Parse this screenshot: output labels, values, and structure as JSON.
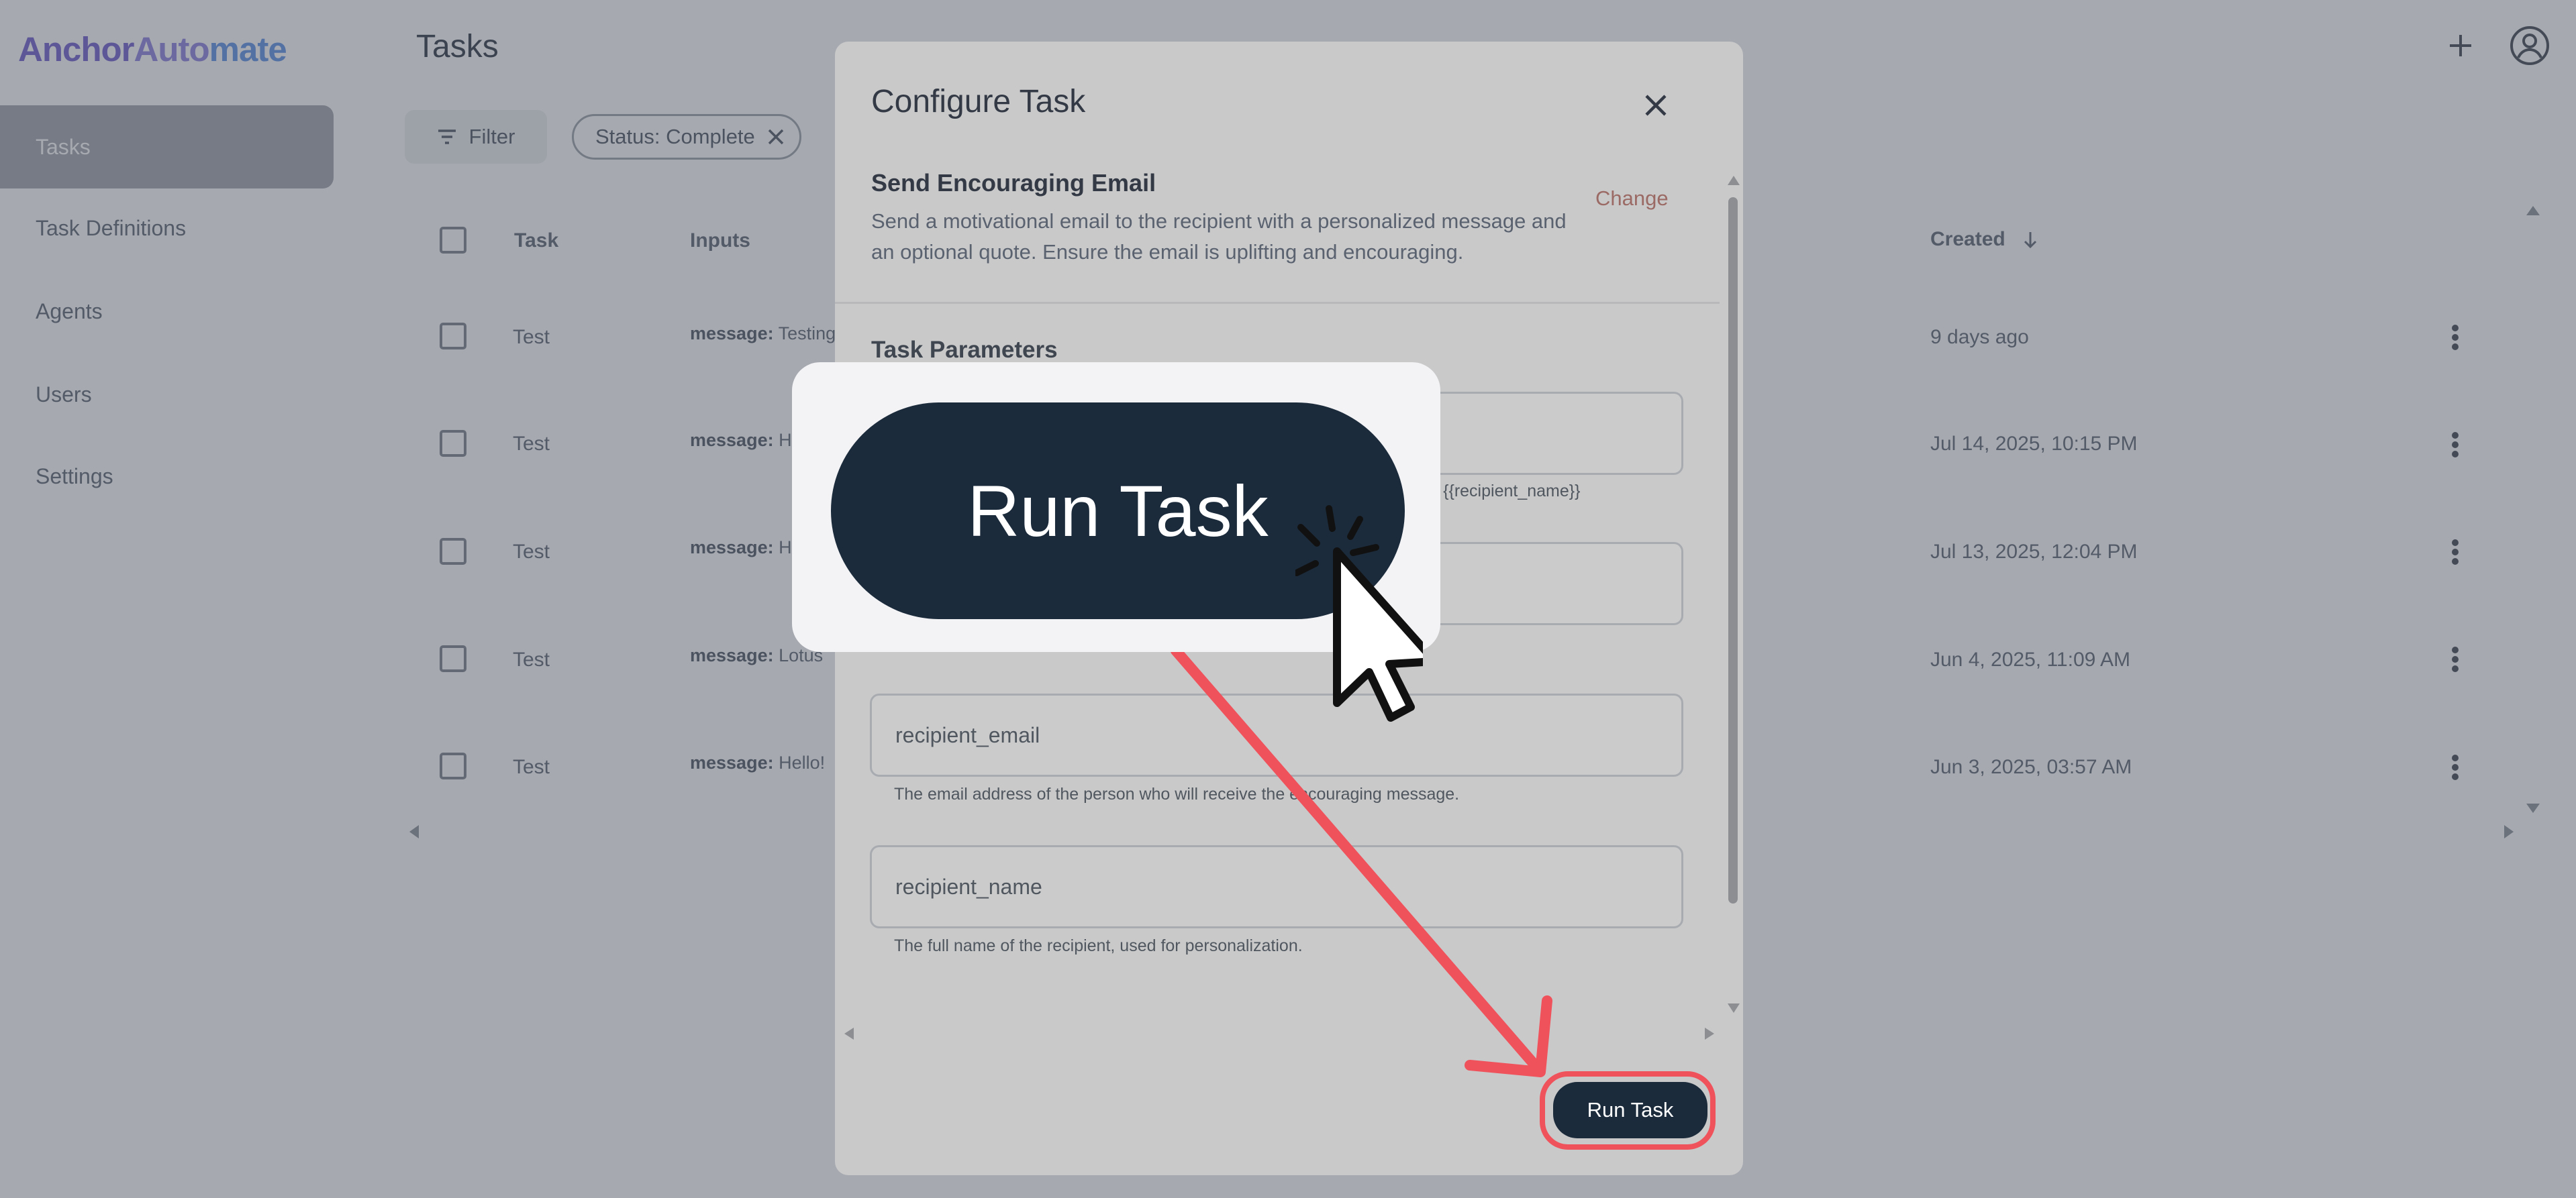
{
  "app": {
    "logo": {
      "part1": "Anchor",
      "part2": "Aut",
      "part3": "o",
      "part4": "mate"
    },
    "sidebar": {
      "items": [
        {
          "label": "Tasks",
          "active": true
        },
        {
          "label": "Task Definitions"
        },
        {
          "label": "Agents"
        },
        {
          "label": "Users"
        },
        {
          "label": "Settings"
        }
      ]
    },
    "header": {
      "title": "Tasks",
      "add_icon": "plus-icon",
      "account_icon": "account-circle-icon"
    },
    "toolbar": {
      "filter_label": "Filter",
      "filter_chip": "Status: Complete"
    },
    "table": {
      "columns": {
        "task": "Task",
        "inputs": "Inputs",
        "created": "Created"
      },
      "rows": [
        {
          "task": "Test",
          "input_key": "message:",
          "input_value": "Testing",
          "created": "9 days ago"
        },
        {
          "task": "Test",
          "input_key": "message:",
          "input_value": "H",
          "created": "Jul 14, 2025, 10:15 PM"
        },
        {
          "task": "Test",
          "input_key": "message:",
          "input_value": "H",
          "created": "Jul 13, 2025, 12:04 PM"
        },
        {
          "task": "Test",
          "input_key": "message:",
          "input_value": "Lotus",
          "created": "Jun 4, 2025, 11:09 AM"
        },
        {
          "task": "Test",
          "input_key": "message:",
          "input_value": "Hello!",
          "created": "Jun 3, 2025, 03:57 AM"
        }
      ]
    }
  },
  "modal": {
    "title": "Configure Task",
    "definition_name": "Send Encouraging Email",
    "definition_description": "Send a motivational email to the recipient with a personalized message and an optional quote. Ensure the email is uplifting and encouraging.",
    "change_label": "Change",
    "section_title": "Task Parameters",
    "fields": [
      {
        "placeholder": "",
        "help": "ers like {{recipient_name}}"
      },
      {
        "placeholder": "",
        "help": ""
      },
      {
        "placeholder": "recipient_email",
        "help": "The email address of the person who will receive the encouraging message."
      },
      {
        "placeholder": "recipient_name",
        "help": "The full name of the recipient, used for personalization."
      }
    ],
    "run_button": "Run Task"
  },
  "callout": {
    "label": "Run Task"
  },
  "colors": {
    "accent": "#f0525b",
    "button": "#1b2b3b",
    "logo": "#6d5bd0"
  }
}
